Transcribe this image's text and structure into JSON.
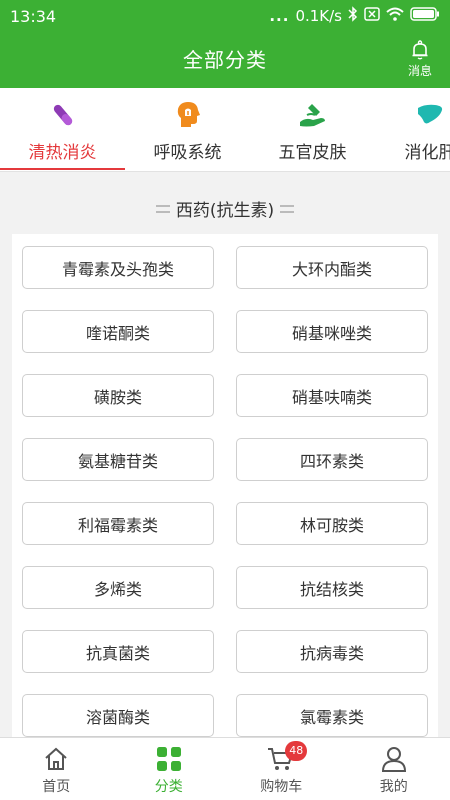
{
  "status_bar": {
    "time": "13:34",
    "dots": "...",
    "speed": "0.1K/s"
  },
  "header": {
    "title": "全部分类",
    "message_label": "消息"
  },
  "tabs": [
    {
      "label": "清热消炎",
      "icon": "pill-icon",
      "active": true
    },
    {
      "label": "呼吸系统",
      "icon": "head-respiratory-icon",
      "active": false
    },
    {
      "label": "五官皮肤",
      "icon": "skin-hand-icon",
      "active": false
    },
    {
      "label": "消化肝",
      "icon": "liver-icon",
      "active": false
    }
  ],
  "section": {
    "title": "西药(抗生素)",
    "items": [
      "青霉素及头孢类",
      "大环内酯类",
      "喹诺酮类",
      "硝基咪唑类",
      "磺胺类",
      "硝基呋喃类",
      "氨基糖苷类",
      "四环素类",
      "利福霉素类",
      "林可胺类",
      "多烯类",
      "抗结核类",
      "抗真菌类",
      "抗病毒类",
      "溶菌酶类",
      "氯霉素类"
    ]
  },
  "bottom_nav": {
    "home": "首页",
    "category": "分类",
    "cart": "购物车",
    "cart_badge": "48",
    "mine": "我的"
  },
  "colors": {
    "brand_green": "#3cb034",
    "accent_red": "#e4393c"
  }
}
